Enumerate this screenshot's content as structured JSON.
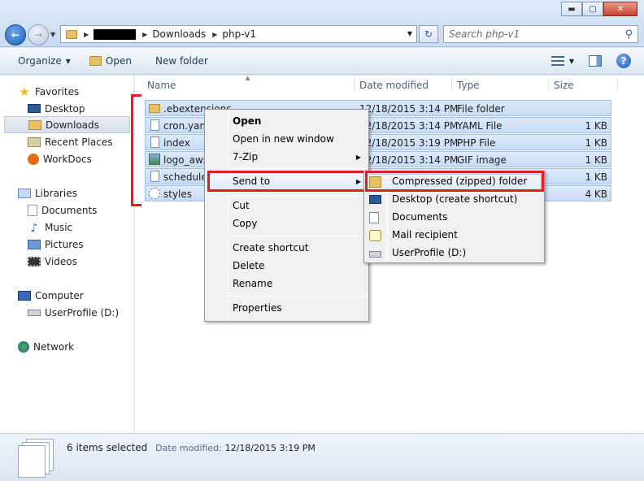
{
  "window": {
    "minimize": "▬",
    "maximize": "▢",
    "close": "✕"
  },
  "address": {
    "crumbs": [
      "Downloads",
      "php-v1"
    ]
  },
  "search": {
    "placeholder": "Search php-v1"
  },
  "toolbar": {
    "organize": "Organize",
    "open": "Open",
    "new_folder": "New folder"
  },
  "nav": {
    "favorites": "Favorites",
    "desktop": "Desktop",
    "downloads": "Downloads",
    "recent": "Recent Places",
    "workdocs": "WorkDocs",
    "libraries": "Libraries",
    "documents": "Documents",
    "music": "Music",
    "pictures": "Pictures",
    "videos": "Videos",
    "computer": "Computer",
    "userprofile": "UserProfile (D:)",
    "network": "Network"
  },
  "columns": {
    "name": "Name",
    "date": "Date modified",
    "type": "Type",
    "size": "Size"
  },
  "files": [
    {
      "name": ".ebextensions",
      "date": "12/18/2015 3:14 PM",
      "type": "File folder",
      "size": "",
      "icon": "folder-icon"
    },
    {
      "name": "cron.yaml",
      "date": "12/18/2015 3:14 PM",
      "type": "YAML File",
      "size": "1 KB",
      "icon": "document-icon"
    },
    {
      "name": "index",
      "date": "12/18/2015 3:19 PM",
      "type": "PHP File",
      "size": "1 KB",
      "icon": "document-icon"
    },
    {
      "name": "logo_aws",
      "date": "12/18/2015 3:14 PM",
      "type": "GIF image",
      "size": "1 KB",
      "icon": "image-icon"
    },
    {
      "name": "scheduled",
      "date": "",
      "type": "",
      "size": "1 KB",
      "icon": "document-icon"
    },
    {
      "name": "styles",
      "date": "",
      "type": "",
      "size": "4 KB",
      "icon": "css-icon"
    }
  ],
  "context_menu": {
    "open": "Open",
    "open_new_window": "Open in new window",
    "seven_zip": "7-Zip",
    "send_to": "Send to",
    "cut": "Cut",
    "copy": "Copy",
    "create_shortcut": "Create shortcut",
    "delete": "Delete",
    "rename": "Rename",
    "properties": "Properties"
  },
  "send_to_menu": {
    "compressed": "Compressed (zipped) folder",
    "desktop": "Desktop (create shortcut)",
    "documents": "Documents",
    "mail": "Mail recipient",
    "userprofile": "UserProfile (D:)"
  },
  "status": {
    "selected": "6 items selected",
    "date_label": "Date modified:",
    "date_value": "12/18/2015 3:19 PM"
  },
  "colors": {
    "highlight_red": "#e02020",
    "selection_blue": "#c7dcf5"
  }
}
